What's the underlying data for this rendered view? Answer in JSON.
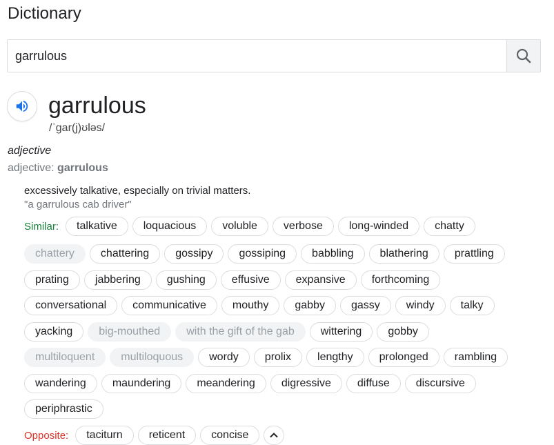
{
  "app_title": "Dictionary",
  "search": {
    "value": "garrulous"
  },
  "entry": {
    "word": "garrulous",
    "phonetic": "/ˈɡar(j)ʊləs/",
    "part_of_speech": "adjective",
    "forms_label": "adjective:",
    "forms_value": "garrulous",
    "definition": "excessively talkative, especially on trivial matters.",
    "example": "\"a garrulous cab driver\""
  },
  "similar": {
    "label": "Similar:",
    "rows": [
      [
        "talkative",
        "loquacious",
        "voluble",
        "verbose",
        "long-winded",
        "chatty"
      ],
      [
        "chattery",
        "chattering",
        "gossipy",
        "gossiping",
        "babbling",
        "blathering",
        "prattling"
      ],
      [
        "prating",
        "jabbering",
        "gushing",
        "effusive",
        "expansive",
        "forthcoming"
      ],
      [
        "conversational",
        "communicative",
        "mouthy",
        "gabby",
        "gassy",
        "windy",
        "talky"
      ],
      [
        "yacking",
        "big-mouthed",
        "with the gift of the gab",
        "wittering",
        "gobby"
      ],
      [
        "multiloquent",
        "multiloquous",
        "wordy",
        "prolix",
        "lengthy",
        "prolonged",
        "rambling"
      ],
      [
        "wandering",
        "maundering",
        "meandering",
        "digressive",
        "diffuse",
        "discursive"
      ],
      [
        "periphrastic"
      ]
    ],
    "faded": [
      "chattery",
      "big-mouthed",
      "with the gift of the gab",
      "multiloquent",
      "multiloquous"
    ]
  },
  "opposite": {
    "label": "Opposite:",
    "words": [
      "taciturn",
      "reticent",
      "concise"
    ]
  },
  "icons": {
    "search": "search-icon",
    "speaker": "speaker-icon",
    "collapse": "chevron-up-icon"
  },
  "colors": {
    "similar_label": "#188038",
    "opposite_label": "#d93025",
    "speaker": "#1a73e8",
    "chip_border": "#dadce0",
    "faded_chip_bg": "#f1f3f4"
  }
}
